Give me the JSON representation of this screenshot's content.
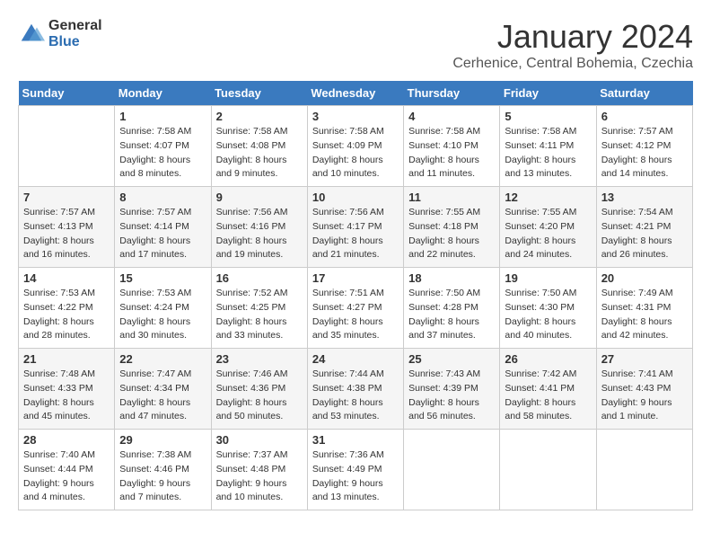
{
  "logo": {
    "general": "General",
    "blue": "Blue"
  },
  "title": "January 2024",
  "location": "Cerhenice, Central Bohemia, Czechia",
  "days_of_week": [
    "Sunday",
    "Monday",
    "Tuesday",
    "Wednesday",
    "Thursday",
    "Friday",
    "Saturday"
  ],
  "weeks": [
    [
      {
        "day": "",
        "sunrise": "",
        "sunset": "",
        "daylight": ""
      },
      {
        "day": "1",
        "sunrise": "Sunrise: 7:58 AM",
        "sunset": "Sunset: 4:07 PM",
        "daylight": "Daylight: 8 hours and 8 minutes."
      },
      {
        "day": "2",
        "sunrise": "Sunrise: 7:58 AM",
        "sunset": "Sunset: 4:08 PM",
        "daylight": "Daylight: 8 hours and 9 minutes."
      },
      {
        "day": "3",
        "sunrise": "Sunrise: 7:58 AM",
        "sunset": "Sunset: 4:09 PM",
        "daylight": "Daylight: 8 hours and 10 minutes."
      },
      {
        "day": "4",
        "sunrise": "Sunrise: 7:58 AM",
        "sunset": "Sunset: 4:10 PM",
        "daylight": "Daylight: 8 hours and 11 minutes."
      },
      {
        "day": "5",
        "sunrise": "Sunrise: 7:58 AM",
        "sunset": "Sunset: 4:11 PM",
        "daylight": "Daylight: 8 hours and 13 minutes."
      },
      {
        "day": "6",
        "sunrise": "Sunrise: 7:57 AM",
        "sunset": "Sunset: 4:12 PM",
        "daylight": "Daylight: 8 hours and 14 minutes."
      }
    ],
    [
      {
        "day": "7",
        "sunrise": "Sunrise: 7:57 AM",
        "sunset": "Sunset: 4:13 PM",
        "daylight": "Daylight: 8 hours and 16 minutes."
      },
      {
        "day": "8",
        "sunrise": "Sunrise: 7:57 AM",
        "sunset": "Sunset: 4:14 PM",
        "daylight": "Daylight: 8 hours and 17 minutes."
      },
      {
        "day": "9",
        "sunrise": "Sunrise: 7:56 AM",
        "sunset": "Sunset: 4:16 PM",
        "daylight": "Daylight: 8 hours and 19 minutes."
      },
      {
        "day": "10",
        "sunrise": "Sunrise: 7:56 AM",
        "sunset": "Sunset: 4:17 PM",
        "daylight": "Daylight: 8 hours and 21 minutes."
      },
      {
        "day": "11",
        "sunrise": "Sunrise: 7:55 AM",
        "sunset": "Sunset: 4:18 PM",
        "daylight": "Daylight: 8 hours and 22 minutes."
      },
      {
        "day": "12",
        "sunrise": "Sunrise: 7:55 AM",
        "sunset": "Sunset: 4:20 PM",
        "daylight": "Daylight: 8 hours and 24 minutes."
      },
      {
        "day": "13",
        "sunrise": "Sunrise: 7:54 AM",
        "sunset": "Sunset: 4:21 PM",
        "daylight": "Daylight: 8 hours and 26 minutes."
      }
    ],
    [
      {
        "day": "14",
        "sunrise": "Sunrise: 7:53 AM",
        "sunset": "Sunset: 4:22 PM",
        "daylight": "Daylight: 8 hours and 28 minutes."
      },
      {
        "day": "15",
        "sunrise": "Sunrise: 7:53 AM",
        "sunset": "Sunset: 4:24 PM",
        "daylight": "Daylight: 8 hours and 30 minutes."
      },
      {
        "day": "16",
        "sunrise": "Sunrise: 7:52 AM",
        "sunset": "Sunset: 4:25 PM",
        "daylight": "Daylight: 8 hours and 33 minutes."
      },
      {
        "day": "17",
        "sunrise": "Sunrise: 7:51 AM",
        "sunset": "Sunset: 4:27 PM",
        "daylight": "Daylight: 8 hours and 35 minutes."
      },
      {
        "day": "18",
        "sunrise": "Sunrise: 7:50 AM",
        "sunset": "Sunset: 4:28 PM",
        "daylight": "Daylight: 8 hours and 37 minutes."
      },
      {
        "day": "19",
        "sunrise": "Sunrise: 7:50 AM",
        "sunset": "Sunset: 4:30 PM",
        "daylight": "Daylight: 8 hours and 40 minutes."
      },
      {
        "day": "20",
        "sunrise": "Sunrise: 7:49 AM",
        "sunset": "Sunset: 4:31 PM",
        "daylight": "Daylight: 8 hours and 42 minutes."
      }
    ],
    [
      {
        "day": "21",
        "sunrise": "Sunrise: 7:48 AM",
        "sunset": "Sunset: 4:33 PM",
        "daylight": "Daylight: 8 hours and 45 minutes."
      },
      {
        "day": "22",
        "sunrise": "Sunrise: 7:47 AM",
        "sunset": "Sunset: 4:34 PM",
        "daylight": "Daylight: 8 hours and 47 minutes."
      },
      {
        "day": "23",
        "sunrise": "Sunrise: 7:46 AM",
        "sunset": "Sunset: 4:36 PM",
        "daylight": "Daylight: 8 hours and 50 minutes."
      },
      {
        "day": "24",
        "sunrise": "Sunrise: 7:44 AM",
        "sunset": "Sunset: 4:38 PM",
        "daylight": "Daylight: 8 hours and 53 minutes."
      },
      {
        "day": "25",
        "sunrise": "Sunrise: 7:43 AM",
        "sunset": "Sunset: 4:39 PM",
        "daylight": "Daylight: 8 hours and 56 minutes."
      },
      {
        "day": "26",
        "sunrise": "Sunrise: 7:42 AM",
        "sunset": "Sunset: 4:41 PM",
        "daylight": "Daylight: 8 hours and 58 minutes."
      },
      {
        "day": "27",
        "sunrise": "Sunrise: 7:41 AM",
        "sunset": "Sunset: 4:43 PM",
        "daylight": "Daylight: 9 hours and 1 minute."
      }
    ],
    [
      {
        "day": "28",
        "sunrise": "Sunrise: 7:40 AM",
        "sunset": "Sunset: 4:44 PM",
        "daylight": "Daylight: 9 hours and 4 minutes."
      },
      {
        "day": "29",
        "sunrise": "Sunrise: 7:38 AM",
        "sunset": "Sunset: 4:46 PM",
        "daylight": "Daylight: 9 hours and 7 minutes."
      },
      {
        "day": "30",
        "sunrise": "Sunrise: 7:37 AM",
        "sunset": "Sunset: 4:48 PM",
        "daylight": "Daylight: 9 hours and 10 minutes."
      },
      {
        "day": "31",
        "sunrise": "Sunrise: 7:36 AM",
        "sunset": "Sunset: 4:49 PM",
        "daylight": "Daylight: 9 hours and 13 minutes."
      },
      {
        "day": "",
        "sunrise": "",
        "sunset": "",
        "daylight": ""
      },
      {
        "day": "",
        "sunrise": "",
        "sunset": "",
        "daylight": ""
      },
      {
        "day": "",
        "sunrise": "",
        "sunset": "",
        "daylight": ""
      }
    ]
  ]
}
